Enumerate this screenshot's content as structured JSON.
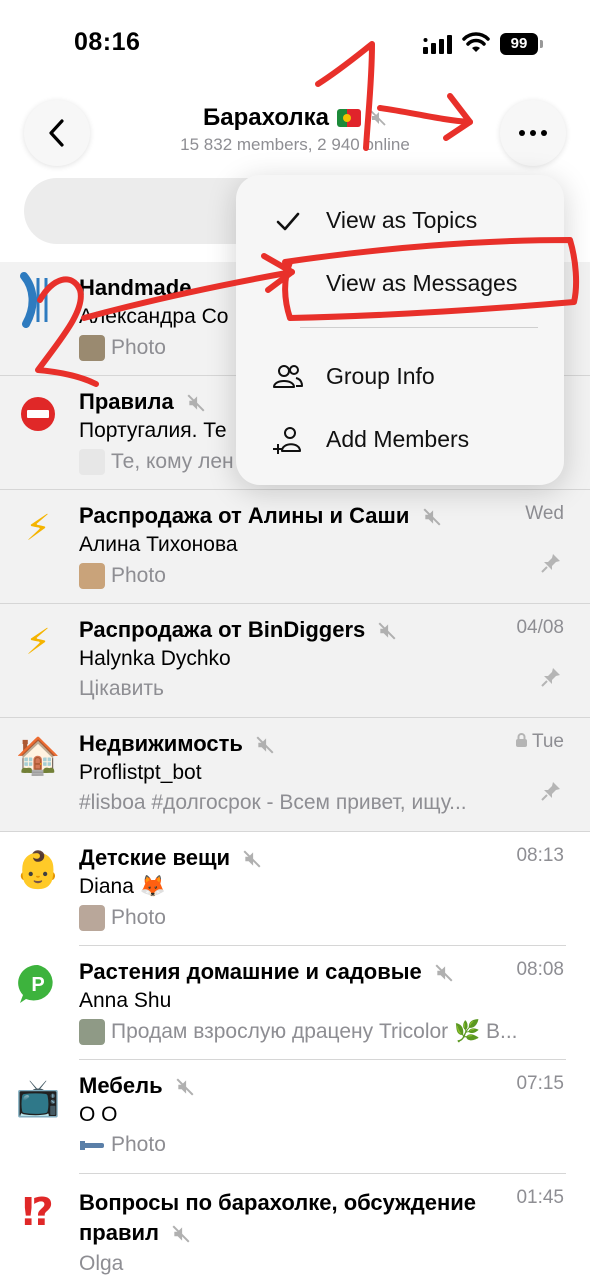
{
  "status": {
    "time": "08:16",
    "battery": "99"
  },
  "header": {
    "title": "Барахолка",
    "subtitle": "15 832 members, 2 940 online"
  },
  "menu": {
    "items": [
      {
        "label": "View as Topics",
        "checked": true,
        "icon": "checkmark-icon"
      },
      {
        "label": "View as Messages",
        "checked": false,
        "icon": ""
      },
      {
        "label": "Group Info",
        "icon": "people-icon"
      },
      {
        "label": "Add Members",
        "icon": "add-person-icon"
      }
    ]
  },
  "annotations": {
    "step1": "1",
    "step2": "2"
  },
  "topics": [
    {
      "name": "Handmade",
      "sender": "Александра Со",
      "preview": "Photo",
      "time": "",
      "avatar": "sardine-logo",
      "muted": true
    },
    {
      "name": "Правила",
      "sender": "Португалия. Те",
      "preview": "Те, кому лен",
      "time": "",
      "avatar": "⛔",
      "muted": true
    },
    {
      "name": "Распродажа от Алины и Саши",
      "sender": "Алина Тихонова",
      "preview": "Photo",
      "time": "Wed",
      "avatar": "⚡",
      "muted": true,
      "pinned": true
    },
    {
      "name": "Распродажа от BinDiggers",
      "sender": "Halynka Dychko",
      "preview": "Цікавить",
      "time": "04/08",
      "avatar": "⚡",
      "muted": true,
      "pinned": true
    },
    {
      "name": "Недвижимость",
      "sender": "Proflistpt_bot",
      "preview": "#lisboa #долгосрок - Всем привет, ищу...",
      "time": "Tue",
      "avatar": "🏠",
      "muted": true,
      "pinned": true,
      "locked": true
    },
    {
      "name": "Детские вещи",
      "sender": "Diana 🦊",
      "preview": "Photo",
      "time": "08:13",
      "avatar": "👶",
      "muted": true
    },
    {
      "name": "Растения домашние и садовые",
      "sender": "Anna Shu",
      "preview": "Продам взрослую драцену Tricolor 🌿 В...",
      "time": "08:08",
      "avatar": "P",
      "muted": true
    },
    {
      "name": "Мебель",
      "sender": "О О",
      "preview": "Photo",
      "time": "07:15",
      "avatar": "📺",
      "muted": true
    },
    {
      "name": "Вопросы по барахолке, обсуждение правил",
      "sender": "Olga",
      "preview": "",
      "time": "01:45",
      "avatar": "⁉️",
      "muted": true
    }
  ]
}
